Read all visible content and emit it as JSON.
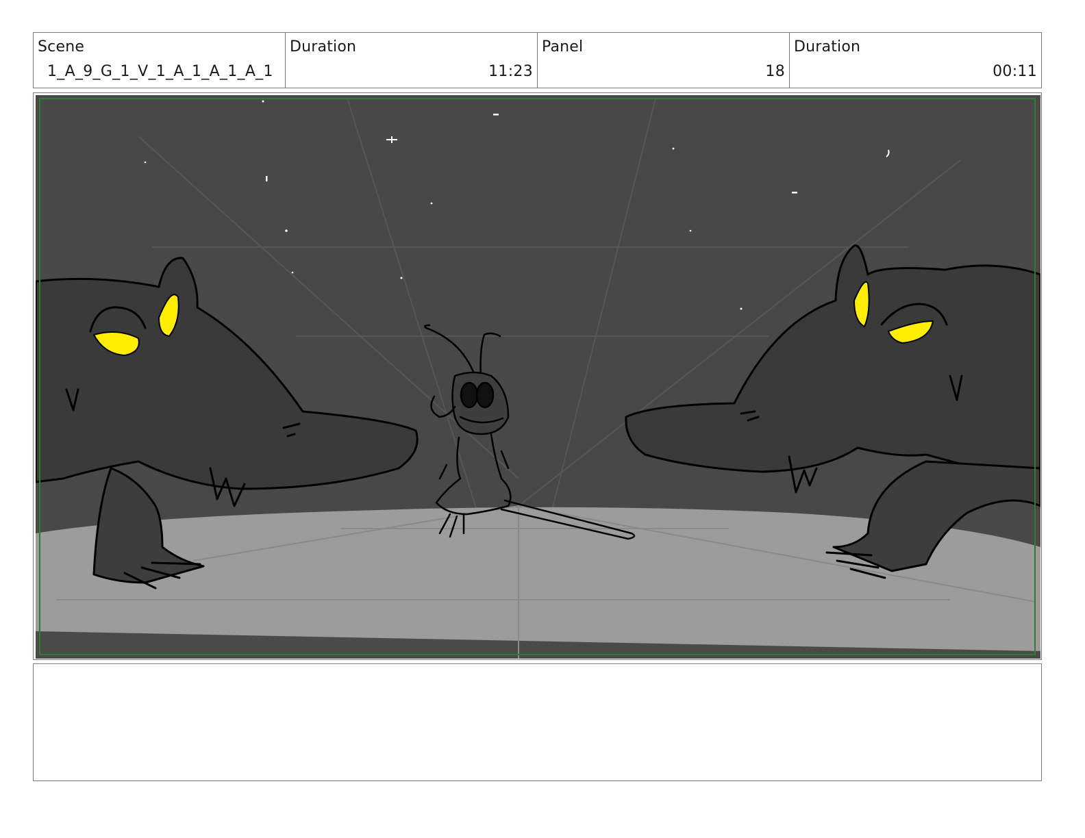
{
  "header": {
    "scene_label": "Scene",
    "scene_value": "1_A_9_G_1_V_1_A_1_A_1_A_1",
    "duration_label": "Duration",
    "duration_value": "11:23",
    "panel_label": "Panel",
    "panel_value": "18",
    "panel_duration_label": "Duration",
    "panel_duration_value": "00:11"
  },
  "panel_image": {
    "description_icon": "storyboard-sketch",
    "colors": {
      "sky": "#484848",
      "floor": "#9c9c9c",
      "creature_body": "#3a3a3a",
      "creature_eyes": "#ffee00",
      "safe_frame": "#2e7d2e"
    }
  },
  "notes": {
    "text": ""
  }
}
